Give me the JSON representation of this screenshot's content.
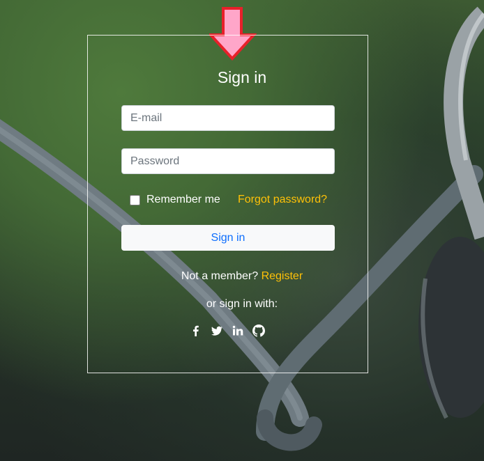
{
  "form": {
    "title": "Sign in",
    "email_placeholder": "E-mail",
    "password_placeholder": "Password",
    "remember_label": "Remember me",
    "forgot_link": "Forgot password?",
    "submit_label": "Sign in",
    "not_member_text": "Not a member?",
    "register_link": "Register",
    "social_text": "or sign in with:"
  },
  "social_icons": [
    "facebook-icon",
    "twitter-icon",
    "linkedin-icon",
    "github-icon"
  ],
  "colors": {
    "link": "#ffc107",
    "button_text": "#0d6efd",
    "arrow_fill": "#ffa6c9",
    "arrow_stroke": "#e8202a"
  }
}
